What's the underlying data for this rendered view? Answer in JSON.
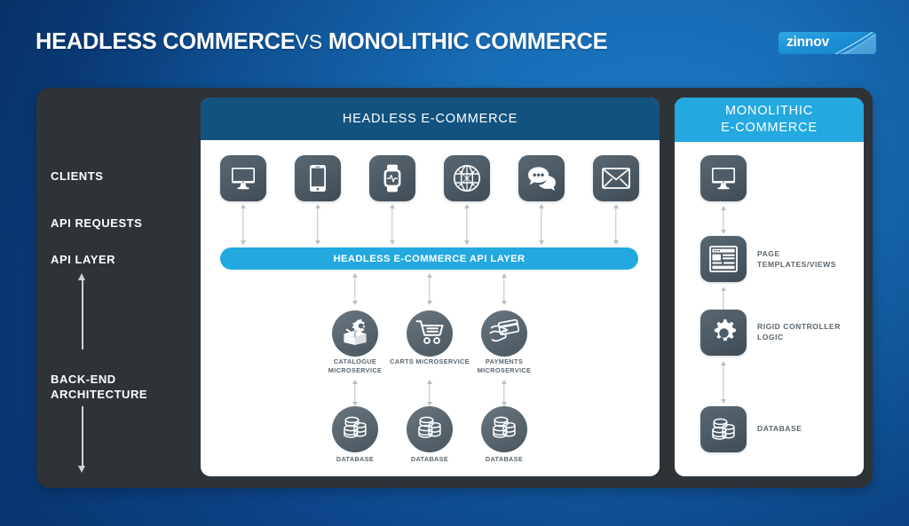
{
  "header": {
    "title_main_1": "HEADLESS COMMERCE",
    "title_vs": "VS",
    "title_main_2": "MONOLITHIC COMMERCE",
    "logo_text": "zinnov",
    "logo_icon": "swoosh-icon"
  },
  "colors": {
    "background_blue": "#11589f",
    "panel_dark": "#2e3338",
    "headless_header": "#12527f",
    "monolithic_header": "#23a9e0",
    "api_layer": "#23a9e0",
    "icon_tile": "#4e5c67",
    "caption_gray": "#5a6670",
    "connector_gray": "#b9c0c5"
  },
  "sidebar": {
    "labels": [
      {
        "text": "CLIENTS"
      },
      {
        "text": "API REQUESTS"
      },
      {
        "text": "API LAYER"
      },
      {
        "text": "BACK-END ARCHITECTURE"
      }
    ],
    "arrow_icon": "double-headed-vertical-arrow-icon"
  },
  "headless": {
    "header": "HEADLESS E-COMMERCE",
    "clients": [
      {
        "label": "desktop",
        "icon": "desktop-monitor-icon"
      },
      {
        "label": "mobile",
        "icon": "mobile-phone-icon"
      },
      {
        "label": "wearable",
        "icon": "smartwatch-icon"
      },
      {
        "label": "web",
        "icon": "globe-icon"
      },
      {
        "label": "chat",
        "icon": "chat-bubbles-icon"
      },
      {
        "label": "email",
        "icon": "envelope-icon"
      }
    ],
    "api_layer_label": "HEADLESS E-COMMERCE API LAYER",
    "microservices": [
      {
        "name": "CATALOGUE MICROSERVICE",
        "icon": "open-box-gear-icon",
        "db": "DATABASE"
      },
      {
        "name": "CARTS MICROSERVICE",
        "icon": "shopping-cart-icon",
        "db": "DATABASE"
      },
      {
        "name": "PAYMENTS MICROSERVICE",
        "icon": "hand-credit-card-icon",
        "db": "DATABASE"
      }
    ],
    "database_label": "DATABASE"
  },
  "monolithic": {
    "header_line_1": "MONOLITHIC",
    "header_line_2": "E-COMMERCE",
    "stack": [
      {
        "label": "",
        "icon": "desktop-monitor-icon"
      },
      {
        "label": "PAGE TEMPLATES/VIEWS",
        "icon": "page-template-icon"
      },
      {
        "label": "RIGID CONTROLLER LOGIC",
        "icon": "gear-icon"
      },
      {
        "label": "DATABASE",
        "icon": "database-icon"
      }
    ]
  }
}
